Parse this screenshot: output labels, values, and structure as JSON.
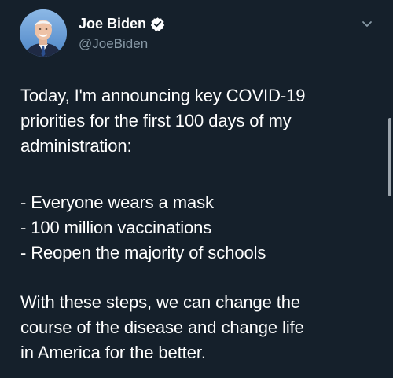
{
  "user": {
    "display_name": "Joe Biden",
    "handle": "@JoeBiden",
    "verified": true
  },
  "tweet": {
    "intro_lines": [
      "Today, I'm announcing key COVID-19",
      "priorities for the first 100 days of my",
      "administration:"
    ],
    "list_lines": [
      "- Everyone wears a mask",
      "- 100 million vaccinations",
      "- Reopen the majority of schools"
    ],
    "closing_lines": [
      "With these steps, we can change the",
      "course of the disease and change life",
      "in America for the better."
    ]
  },
  "colors": {
    "background": "#15202b",
    "text": "#ffffff",
    "secondary_text": "#8899a6",
    "verified_badge": "#ffffff"
  },
  "icons": {
    "verified": "verified-badge-icon",
    "menu": "chevron-down-icon"
  }
}
